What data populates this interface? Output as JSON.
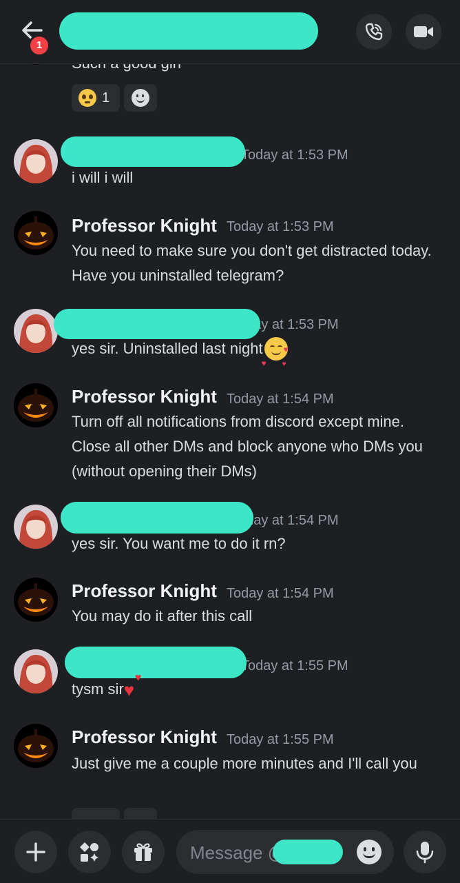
{
  "header": {
    "back_label": "back",
    "notification_count": "1"
  },
  "messages": [
    {
      "partial": true,
      "text": "Such a good girl",
      "reactions": [
        {
          "emoji": "pleading-face",
          "count": "1"
        }
      ]
    },
    {
      "author": "",
      "time": "Today at 1:53 PM",
      "text": "i will i will"
    },
    {
      "author": "Professor Knight",
      "time": "Today at 1:53 PM",
      "text": "You need to make sure you don't get distracted today. Have you uninstalled telegram?"
    },
    {
      "author": "",
      "time": "Today at 1:53 PM",
      "text": "yes sir. Uninstalled last night"
    },
    {
      "author": "Professor Knight",
      "time": "Today at 1:54 PM",
      "text": "Turn off all notifications from discord except mine. Close all other DMs and block anyone who DMs you (without opening their DMs)"
    },
    {
      "author": "",
      "time": "Today at 1:54 PM",
      "text": "yes sir. You want me to do it rn?"
    },
    {
      "author": "Professor Knight",
      "time": "Today at 1:54 PM",
      "text": "You may do it after this call"
    },
    {
      "author": "",
      "time": "Today at 1:55 PM",
      "text": "tysm sir"
    },
    {
      "author": "Professor Knight",
      "time": "Today at 1:55 PM",
      "text": "Just give me a couple more minutes and I'll call you"
    }
  ],
  "composer": {
    "placeholder": "Message @"
  },
  "colors": {
    "redaction": "#3ee6c8",
    "background": "#1e1f22",
    "badge": "#f23f43"
  }
}
